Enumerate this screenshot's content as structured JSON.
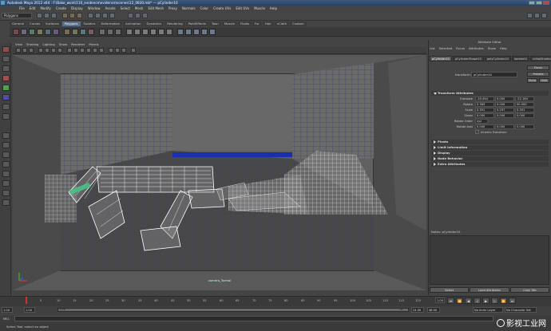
{
  "window": {
    "title": "Autodesk Maya 2012 x64 : F:\\Bake_work\\110_evidence\\evidence\\scenes\\12_0830.mb*  ---  pCylinder10"
  },
  "menubar": [
    "File",
    "Edit",
    "Modify",
    "Create",
    "Display",
    "Window",
    "Assets",
    "Select",
    "Mesh",
    "Edit Mesh",
    "Proxy",
    "Normals",
    "Color",
    "Create UVs",
    "Edit UVs",
    "Muscle",
    "Help"
  ],
  "statusline": {
    "mode": "Polygons"
  },
  "shelf": {
    "tabs": [
      "General",
      "Curves",
      "Surfaces",
      "Polygons",
      "Subdivs",
      "Deformation",
      "Animation",
      "Dynamics",
      "Rendering",
      "PaintEffects",
      "Toon",
      "Muscle",
      "Fluids",
      "Fur",
      "Hair",
      "nCloth",
      "Custom"
    ],
    "active": "Polygons"
  },
  "viewport": {
    "menu": [
      "View",
      "Shading",
      "Lighting",
      "Show",
      "Renderer",
      "Panels"
    ],
    "camera_label": "camera_Tormal"
  },
  "attribute_editor": {
    "title": "Attribute Editor",
    "menu": [
      "List",
      "Selected",
      "Focus",
      "Attributes",
      "Show",
      "Help"
    ],
    "tabs": [
      "pCylinder10",
      "pCylinderShape10",
      "polyCylinder10",
      "lambert1",
      "initialShadingGroup"
    ],
    "active_tab": "pCylinder10",
    "transform_label": "transform:",
    "transform_value": "pCylinder10",
    "focus_label": "Focus",
    "presets_label": "Presets",
    "show_label": "Show",
    "hide_label": "Hide",
    "transform_section": "Transform Attributes",
    "rows": [
      {
        "label": "Translate",
        "values": [
          "-35.494",
          "0.000",
          "-52.164"
        ]
      },
      {
        "label": "Rotate",
        "values": [
          "0.363",
          "0.000",
          "90.000"
        ]
      },
      {
        "label": "Scale",
        "values": [
          "0.391",
          "0.297",
          "0.391"
        ]
      },
      {
        "label": "Shear",
        "values": [
          "0.000",
          "0.000",
          "0.000"
        ]
      },
      {
        "label": "Rotate Order",
        "values": [
          "xyz"
        ]
      },
      {
        "label": "Rotate Axis",
        "values": [
          "0.000",
          "0.000",
          "0.000"
        ]
      }
    ],
    "inherits": "Inherits Transform",
    "sections": [
      "Pivots",
      "Limit Information",
      "Display",
      "Node Behavior",
      "Extra Attributes"
    ],
    "notes_label": "Notes: pCylinder10",
    "buttons": [
      "Select",
      "Load Attributes",
      "Copy Tab"
    ]
  },
  "timeline": {
    "ticks": [
      "5",
      "10",
      "15",
      "20",
      "25",
      "30",
      "35",
      "40",
      "45",
      "50",
      "55",
      "60",
      "65",
      "70",
      "75",
      "80",
      "85",
      "90",
      "95",
      "100",
      "105",
      "110",
      "115",
      "120"
    ],
    "current": "1.00"
  },
  "range": {
    "start": "1.00",
    "start2": "1.00",
    "end_inner": "24",
    "end": "24.00",
    "end2": "48.00",
    "anim_layer": "No Anim Layer",
    "char_set": "No Character Set"
  },
  "cmdline": {
    "label": "MEL"
  },
  "helpline": {
    "text": "Select Tool: select an object"
  },
  "watermark": {
    "text": "影视工业网"
  }
}
